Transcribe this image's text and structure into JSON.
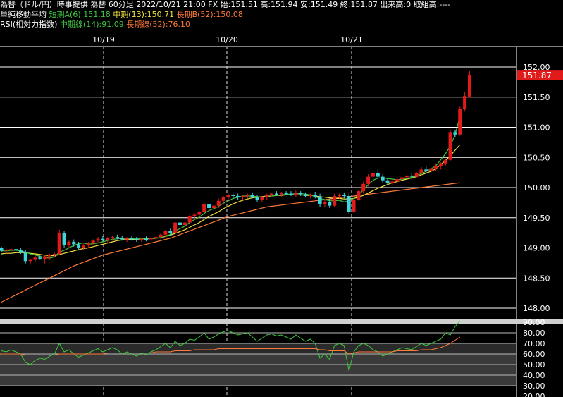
{
  "header": {
    "line1": "為替（ドル/円）時事提供 為替 60分足 2022/10/21 21:00 FX 始:151.51 高:151.94 安:151.49 終:151.87 出来高:0 取組高:----",
    "ma_title": "単純移動平均",
    "ma_short": "短期A(6):151.18",
    "ma_mid": "中期(13):150.71",
    "ma_long": "長期B(52):150.08",
    "rsi_title": "RSI(相対力指数)",
    "rsi_mid": "中期線(14):91.09",
    "rsi_long": "長期線(52):76.10"
  },
  "colors": {
    "up": "#e11a1a",
    "down": "#3fd5dc",
    "ma_short": "#3ec83e",
    "ma_mid": "#f0e040",
    "ma_long": "#ff7a3a",
    "price_tag": "#e11a1a"
  },
  "chart_data": [
    {
      "type": "candlestick",
      "title": "為替（ドル/円）60分足",
      "x_labels": [
        "10/19",
        "10/20",
        "10/21"
      ],
      "ylim": [
        147.8,
        152.2
      ],
      "yticks": [
        "152.00",
        "151.50",
        "151.00",
        "150.50",
        "150.00",
        "149.50",
        "149.00",
        "148.50",
        "148.00"
      ],
      "last_price": "151.87",
      "candles": [
        [
          149.0,
          149.02,
          148.93,
          148.95
        ],
        [
          148.95,
          148.99,
          148.9,
          148.97
        ],
        [
          148.97,
          149.01,
          148.93,
          148.98
        ],
        [
          148.98,
          149.02,
          148.94,
          148.96
        ],
        [
          148.96,
          149.0,
          148.9,
          148.92
        ],
        [
          148.92,
          148.96,
          148.74,
          148.78
        ],
        [
          148.78,
          148.82,
          148.72,
          148.8
        ],
        [
          148.8,
          148.88,
          148.76,
          148.84
        ],
        [
          148.84,
          148.88,
          148.8,
          148.82
        ],
        [
          148.82,
          148.88,
          148.74,
          148.86
        ],
        [
          148.86,
          148.9,
          148.8,
          148.88
        ],
        [
          148.88,
          148.92,
          148.84,
          148.9
        ],
        [
          148.9,
          149.3,
          148.88,
          149.25
        ],
        [
          149.25,
          149.28,
          149.0,
          149.05
        ],
        [
          149.05,
          149.12,
          149.0,
          149.1
        ],
        [
          149.1,
          149.14,
          149.02,
          149.06
        ],
        [
          149.06,
          149.1,
          148.96,
          149.0
        ],
        [
          149.0,
          149.06,
          148.96,
          149.04
        ],
        [
          149.04,
          149.1,
          149.0,
          149.08
        ],
        [
          149.08,
          149.14,
          149.04,
          149.12
        ],
        [
          149.12,
          149.18,
          149.08,
          149.15
        ],
        [
          149.15,
          149.2,
          149.1,
          149.13
        ],
        [
          149.13,
          149.18,
          149.08,
          149.16
        ],
        [
          149.16,
          149.2,
          149.12,
          149.18
        ],
        [
          149.18,
          149.22,
          149.14,
          149.17
        ],
        [
          149.17,
          149.2,
          149.12,
          149.14
        ],
        [
          149.14,
          149.18,
          149.1,
          149.16
        ],
        [
          149.16,
          149.2,
          149.12,
          149.15
        ],
        [
          149.15,
          149.18,
          149.1,
          149.13
        ],
        [
          149.13,
          149.17,
          149.1,
          149.15
        ],
        [
          149.15,
          149.19,
          149.11,
          149.14
        ],
        [
          149.14,
          149.18,
          149.1,
          149.16
        ],
        [
          149.16,
          149.2,
          149.12,
          149.18
        ],
        [
          149.18,
          149.24,
          149.14,
          149.22
        ],
        [
          149.22,
          149.3,
          149.18,
          149.28
        ],
        [
          149.28,
          149.32,
          149.2,
          149.24
        ],
        [
          149.24,
          149.46,
          149.22,
          149.42
        ],
        [
          149.42,
          149.46,
          149.34,
          149.38
        ],
        [
          149.38,
          149.44,
          149.34,
          149.42
        ],
        [
          149.42,
          149.56,
          149.4,
          149.52
        ],
        [
          149.52,
          149.58,
          149.46,
          149.55
        ],
        [
          149.55,
          149.62,
          149.5,
          149.6
        ],
        [
          149.6,
          149.75,
          149.56,
          149.72
        ],
        [
          149.72,
          149.76,
          149.62,
          149.66
        ],
        [
          149.66,
          149.72,
          149.6,
          149.7
        ],
        [
          149.7,
          149.82,
          149.66,
          149.78
        ],
        [
          149.78,
          149.86,
          149.74,
          149.84
        ],
        [
          149.84,
          149.9,
          149.8,
          149.88
        ],
        [
          149.88,
          149.92,
          149.82,
          149.86
        ],
        [
          149.86,
          149.9,
          149.8,
          149.84
        ],
        [
          149.84,
          149.88,
          149.8,
          149.86
        ],
        [
          149.86,
          149.9,
          149.82,
          149.88
        ],
        [
          149.88,
          149.92,
          149.82,
          149.84
        ],
        [
          149.84,
          149.88,
          149.76,
          149.8
        ],
        [
          149.8,
          149.86,
          149.76,
          149.84
        ],
        [
          149.84,
          149.9,
          149.8,
          149.88
        ],
        [
          149.88,
          149.92,
          149.84,
          149.9
        ],
        [
          149.9,
          149.94,
          149.86,
          149.89
        ],
        [
          149.89,
          149.93,
          149.85,
          149.91
        ],
        [
          149.91,
          149.94,
          149.87,
          149.9
        ],
        [
          149.9,
          149.94,
          149.86,
          149.88
        ],
        [
          149.88,
          149.95,
          149.84,
          149.91
        ],
        [
          149.91,
          149.94,
          149.86,
          149.89
        ],
        [
          149.89,
          149.92,
          149.84,
          149.86
        ],
        [
          149.86,
          149.9,
          149.82,
          149.88
        ],
        [
          149.88,
          149.93,
          149.82,
          149.85
        ],
        [
          149.85,
          149.9,
          149.68,
          149.72
        ],
        [
          149.72,
          149.8,
          149.68,
          149.76
        ],
        [
          149.76,
          149.82,
          149.66,
          149.7
        ],
        [
          149.7,
          149.9,
          149.68,
          149.86
        ],
        [
          149.86,
          149.9,
          149.82,
          149.88
        ],
        [
          149.88,
          149.92,
          149.82,
          149.86
        ],
        [
          149.86,
          149.9,
          149.56,
          149.6
        ],
        [
          149.6,
          149.82,
          149.58,
          149.8
        ],
        [
          149.8,
          149.96,
          149.78,
          149.94
        ],
        [
          149.94,
          150.1,
          149.9,
          150.06
        ],
        [
          150.06,
          150.22,
          150.02,
          150.18
        ],
        [
          150.18,
          150.28,
          150.12,
          150.24
        ],
        [
          150.24,
          150.3,
          150.14,
          150.18
        ],
        [
          150.18,
          150.22,
          150.08,
          150.12
        ],
        [
          150.12,
          150.16,
          150.04,
          150.08
        ],
        [
          150.08,
          150.14,
          150.04,
          150.1
        ],
        [
          150.1,
          150.18,
          150.06,
          150.14
        ],
        [
          150.14,
          150.2,
          150.1,
          150.17
        ],
        [
          150.17,
          150.22,
          150.12,
          150.2
        ],
        [
          150.2,
          150.24,
          150.14,
          150.18
        ],
        [
          150.18,
          150.26,
          150.16,
          150.24
        ],
        [
          150.24,
          150.34,
          150.2,
          150.3
        ],
        [
          150.3,
          150.36,
          150.24,
          150.28
        ],
        [
          150.28,
          150.34,
          150.24,
          150.32
        ],
        [
          150.32,
          150.4,
          150.28,
          150.36
        ],
        [
          150.36,
          150.42,
          150.3,
          150.4
        ],
        [
          150.4,
          150.48,
          150.36,
          150.46
        ],
        [
          150.46,
          150.96,
          150.44,
          150.92
        ],
        [
          150.92,
          150.96,
          150.84,
          150.88
        ],
        [
          150.88,
          151.34,
          150.86,
          151.3
        ],
        [
          151.3,
          151.58,
          151.26,
          151.52
        ],
        [
          151.51,
          151.94,
          151.49,
          151.87
        ]
      ],
      "ma_short": [
        148.95,
        148.95,
        148.96,
        148.96,
        148.95,
        148.93,
        148.9,
        148.88,
        148.86,
        148.84,
        148.83,
        148.85,
        148.93,
        148.96,
        149.0,
        149.04,
        149.07,
        149.08,
        149.06,
        149.07,
        149.08,
        149.1,
        149.12,
        149.14,
        149.15,
        149.16,
        149.15,
        149.15,
        149.15,
        149.15,
        149.15,
        149.15,
        149.16,
        149.17,
        149.2,
        149.22,
        149.28,
        149.32,
        149.36,
        149.42,
        149.47,
        149.51,
        149.57,
        149.62,
        149.65,
        149.69,
        149.74,
        149.78,
        149.82,
        149.84,
        149.86,
        149.86,
        149.86,
        149.85,
        149.84,
        149.85,
        149.86,
        149.87,
        149.88,
        149.89,
        149.89,
        149.9,
        149.9,
        149.89,
        149.88,
        149.85,
        149.82,
        149.8,
        149.78,
        149.78,
        149.79,
        149.76,
        149.78,
        149.82,
        149.88,
        149.96,
        150.05,
        150.12,
        150.16,
        150.16,
        150.15,
        150.14,
        150.13,
        150.14,
        150.15,
        150.17,
        150.2,
        150.23,
        150.27,
        150.31,
        150.36,
        150.46,
        150.56,
        150.69,
        150.88,
        151.18
      ],
      "ma_mid": [
        148.9,
        148.91,
        148.91,
        148.92,
        148.92,
        148.92,
        148.91,
        148.9,
        148.89,
        148.88,
        148.87,
        148.87,
        148.89,
        148.91,
        148.93,
        148.95,
        148.97,
        148.99,
        149.0,
        149.02,
        149.04,
        149.06,
        149.08,
        149.1,
        149.12,
        149.13,
        149.14,
        149.14,
        149.14,
        149.15,
        149.15,
        149.15,
        149.16,
        149.17,
        149.19,
        149.21,
        149.24,
        149.27,
        149.3,
        149.34,
        149.38,
        149.42,
        149.47,
        149.52,
        149.56,
        149.6,
        149.65,
        149.69,
        149.73,
        149.76,
        149.79,
        149.81,
        149.83,
        149.84,
        149.85,
        149.86,
        149.86,
        149.87,
        149.87,
        149.88,
        149.88,
        149.88,
        149.88,
        149.87,
        149.87,
        149.86,
        149.85,
        149.84,
        149.83,
        149.82,
        149.82,
        149.81,
        149.81,
        149.82,
        149.84,
        149.87,
        149.91,
        149.95,
        149.99,
        150.02,
        150.05,
        150.08,
        150.1,
        150.12,
        150.14,
        150.16,
        150.18,
        150.21,
        150.24,
        150.27,
        150.31,
        150.38,
        150.45,
        150.53,
        150.62,
        150.71
      ],
      "ma_long": [
        148.1,
        148.14,
        148.18,
        148.22,
        148.26,
        148.3,
        148.34,
        148.38,
        148.42,
        148.46,
        148.5,
        148.54,
        148.58,
        148.62,
        148.66,
        148.7,
        148.73,
        148.76,
        148.79,
        148.82,
        148.85,
        148.88,
        148.9,
        148.92,
        148.94,
        148.96,
        148.98,
        149.0,
        149.02,
        149.04,
        149.06,
        149.08,
        149.1,
        149.12,
        149.14,
        149.16,
        149.19,
        149.22,
        149.25,
        149.28,
        149.31,
        149.34,
        149.37,
        149.4,
        149.43,
        149.46,
        149.49,
        149.52,
        149.54,
        149.56,
        149.58,
        149.6,
        149.62,
        149.64,
        149.66,
        149.68,
        149.69,
        149.7,
        149.71,
        149.72,
        149.73,
        149.74,
        149.75,
        149.76,
        149.77,
        149.78,
        149.79,
        149.8,
        149.81,
        149.82,
        149.83,
        149.84,
        149.85,
        149.86,
        149.87,
        149.88,
        149.89,
        149.9,
        149.91,
        149.92,
        149.93,
        149.94,
        149.95,
        149.96,
        149.97,
        149.98,
        149.99,
        150.0,
        150.01,
        150.02,
        150.03,
        150.04,
        150.05,
        150.06,
        150.07,
        150.08
      ]
    },
    {
      "type": "line",
      "title": "RSI(相対力指数)",
      "ylim": [
        20,
        90
      ],
      "yticks": [
        "90.00",
        "80.00",
        "70.00",
        "60.00",
        "50.00",
        "40.00",
        "30.00",
        "20.00"
      ],
      "series": [
        {
          "name": "中期線(14)",
          "values": [
            63,
            62,
            64,
            62,
            60,
            52,
            50,
            54,
            56,
            55,
            58,
            60,
            70,
            62,
            64,
            60,
            57,
            59,
            61,
            63,
            65,
            62,
            64,
            66,
            64,
            60,
            62,
            60,
            58,
            61,
            59,
            62,
            64,
            67,
            70,
            66,
            72,
            68,
            70,
            74,
            73,
            76,
            80,
            74,
            76,
            79,
            81,
            82,
            80,
            78,
            79,
            80,
            76,
            72,
            75,
            78,
            79,
            77,
            78,
            76,
            74,
            78,
            75,
            72,
            74,
            70,
            56,
            60,
            55,
            68,
            70,
            68,
            44,
            62,
            68,
            70,
            68,
            64,
            62,
            58,
            60,
            62,
            64,
            66,
            65,
            64,
            67,
            70,
            68,
            70,
            72,
            74,
            80,
            78,
            86,
            91.09
          ]
        },
        {
          "name": "長期線(52)",
          "values": [
            60,
            60,
            60,
            60,
            60,
            59,
            59,
            59,
            59,
            59,
            59,
            59,
            60,
            60,
            60,
            60,
            60,
            60,
            60,
            60,
            60,
            60,
            61,
            61,
            61,
            61,
            61,
            61,
            61,
            61,
            61,
            61,
            62,
            62,
            62,
            62,
            63,
            63,
            63,
            63,
            64,
            64,
            64,
            64,
            64,
            65,
            65,
            65,
            65,
            65,
            65,
            65,
            65,
            65,
            65,
            65,
            65,
            65,
            65,
            65,
            65,
            65,
            65,
            65,
            65,
            65,
            64,
            64,
            63,
            63,
            63,
            63,
            60,
            61,
            62,
            62,
            62,
            62,
            62,
            62,
            62,
            62,
            63,
            63,
            63,
            63,
            63,
            64,
            64,
            64,
            65,
            66,
            68,
            70,
            73,
            76.1
          ]
        }
      ]
    }
  ]
}
